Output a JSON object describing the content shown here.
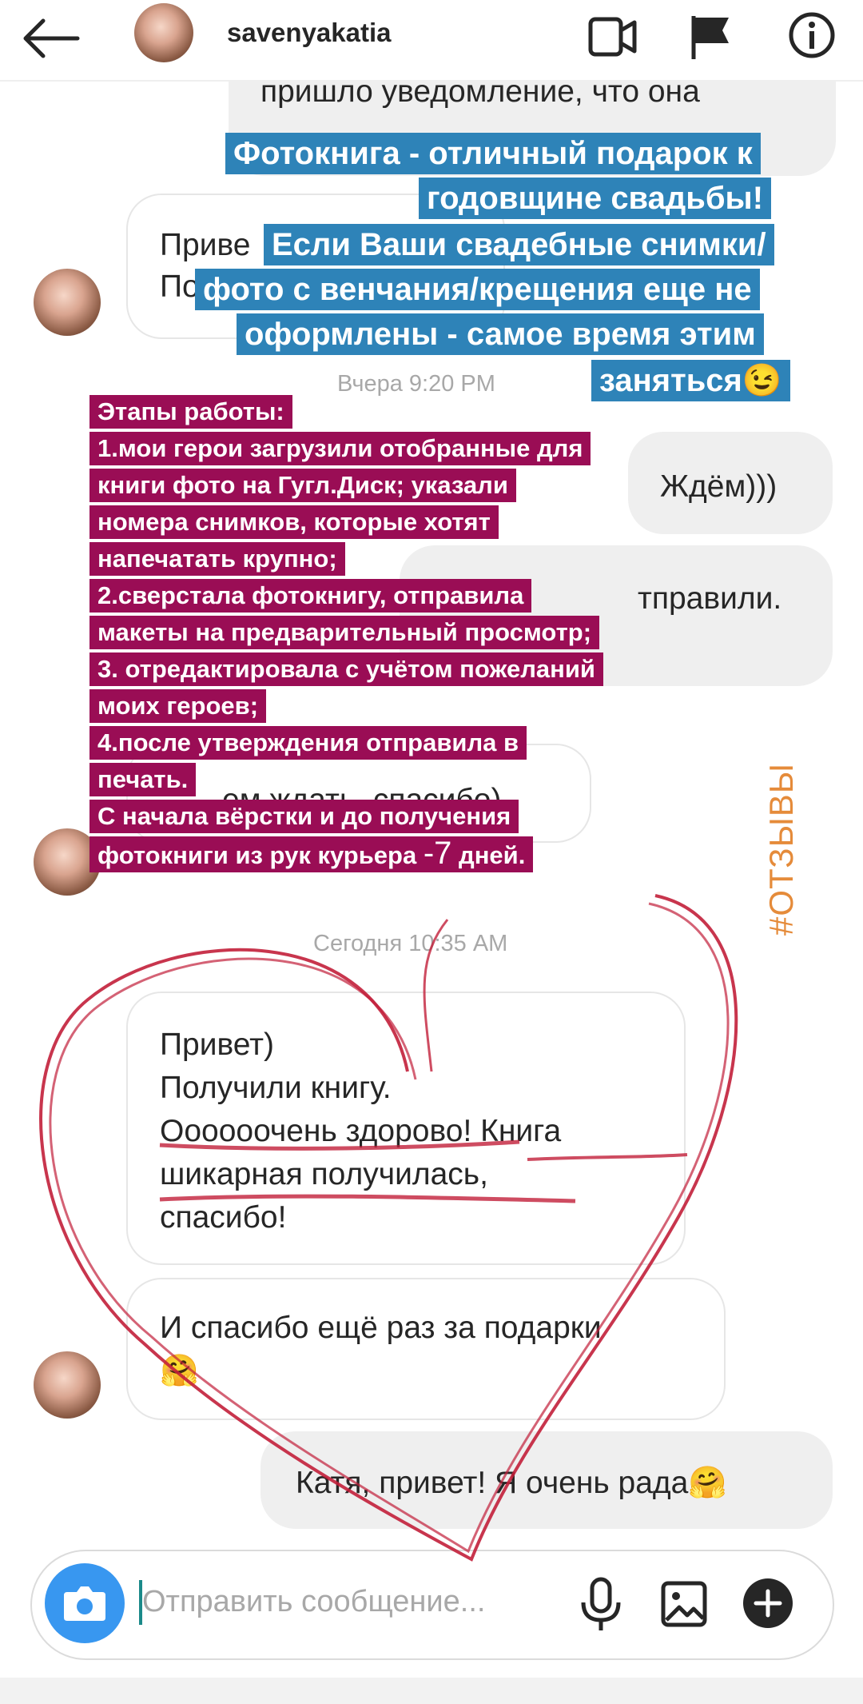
{
  "header": {
    "username": "savenyakatia",
    "back_icon": "arrow-left-icon",
    "video_icon": "video-call-icon",
    "flag_icon": "flag-icon",
    "info_icon": "info-icon"
  },
  "messages": {
    "top_out_partial": "пришло уведомление,  что она",
    "partial_in_1_line1": "Приве",
    "partial_in_1_line2": "По",
    "timestamp_1": "Вчера 9:20 PM",
    "out_waiting": "Ждём)))",
    "out_sent": "тправили.",
    "partial_in_2": "ем ждать, спасибо)",
    "timestamp_2": "Сегодня 10:35 AM",
    "in_main_line1": "Привет)",
    "in_main_line2": "Получили книгу.",
    "in_main_line3": "Оооооочень здорово! Книга",
    "in_main_line4": "шикарная получилась,",
    "in_main_line5": "спасибо!",
    "in_thanks_line1": "И спасибо ещё раз за подарки",
    "in_thanks_emoji": "🤗",
    "out_reply": "Катя, привет! Я очень рада🤗"
  },
  "overlay_blue": [
    "Фотокнига - отличный подарок к",
    "годовщине свадьбы!",
    "Если Ваши свадебные снимки/",
    "фото с венчания/крещения еще не",
    "оформлены - самое время этим",
    "заняться😉"
  ],
  "overlay_red": [
    "Этапы работы:",
    "1.мои герои загрузили отобранные для",
    "книги фото на Гугл.Диск; указали",
    "номера снимков, которые хотят",
    "напечатать крупно;",
    "2.сверстала фотокнигу, отправила",
    "макеты на предварительный просмотр;",
    "3. отредактировала с учётом пожеланий",
    "моих героев;",
    "4.после утверждения отправила в",
    "печать.",
    "С начала вёрстки и до получения",
    "фотокниги из рук курьера ",
    "-7",
    " дней."
  ],
  "hashtag": "#ОТЗЫВЫ",
  "composer": {
    "placeholder": "Отправить сообщение...",
    "camera_icon": "camera-icon",
    "mic_icon": "microphone-icon",
    "gallery_icon": "gallery-icon",
    "plus_icon": "plus-icon"
  },
  "colors": {
    "blue_label": "#2e83b8",
    "red_label": "#9a0d55",
    "camera_button": "#3897f0",
    "hashtag": "#e58b3a",
    "scribble": "#c21f3a"
  }
}
